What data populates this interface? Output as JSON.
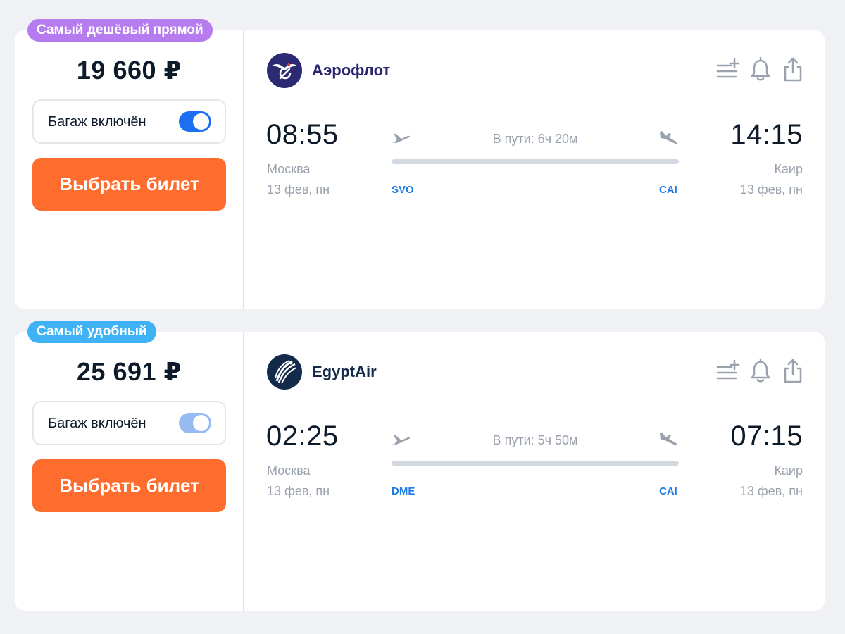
{
  "offers": [
    {
      "badge": {
        "label": "Самый дешёвый прямой",
        "color": "#b67bee"
      },
      "price": "19 660 ₽",
      "baggage": {
        "label": "Багаж включён",
        "toggle_on": true,
        "toggle_color": "#1d6ff2"
      },
      "select_label": "Выбрать билет",
      "airline": {
        "name": "Аэрофлот",
        "logo_icon": "aeroflot-logo",
        "name_color": "#2a2570"
      },
      "actions": [
        "add-to-list-icon",
        "bell-icon",
        "share-icon"
      ],
      "departure": {
        "time": "08:55",
        "city": "Москва",
        "date": "13 фев, пн",
        "iata": "SVO"
      },
      "arrival": {
        "time": "14:15",
        "city": "Каир",
        "date": "13 фев, пн",
        "iata": "CAI"
      },
      "duration": "В пути: 6ч 20м"
    },
    {
      "badge": {
        "label": "Самый удобный",
        "color": "#3fb2f5"
      },
      "price": "25 691 ₽",
      "baggage": {
        "label": "Багаж включён",
        "toggle_on": true,
        "toggle_color": "#97baf3"
      },
      "select_label": "Выбрать билет",
      "airline": {
        "name": "EgyptAir",
        "logo_icon": "egyptair-logo",
        "name_color": "#132a4a"
      },
      "actions": [
        "add-to-list-icon",
        "bell-icon",
        "share-icon"
      ],
      "departure": {
        "time": "02:25",
        "city": "Москва",
        "date": "13 фев, пн",
        "iata": "DME"
      },
      "arrival": {
        "time": "07:15",
        "city": "Каир",
        "date": "13 фев, пн",
        "iata": "CAI"
      },
      "duration": "В пути: 5ч 50м"
    }
  ]
}
